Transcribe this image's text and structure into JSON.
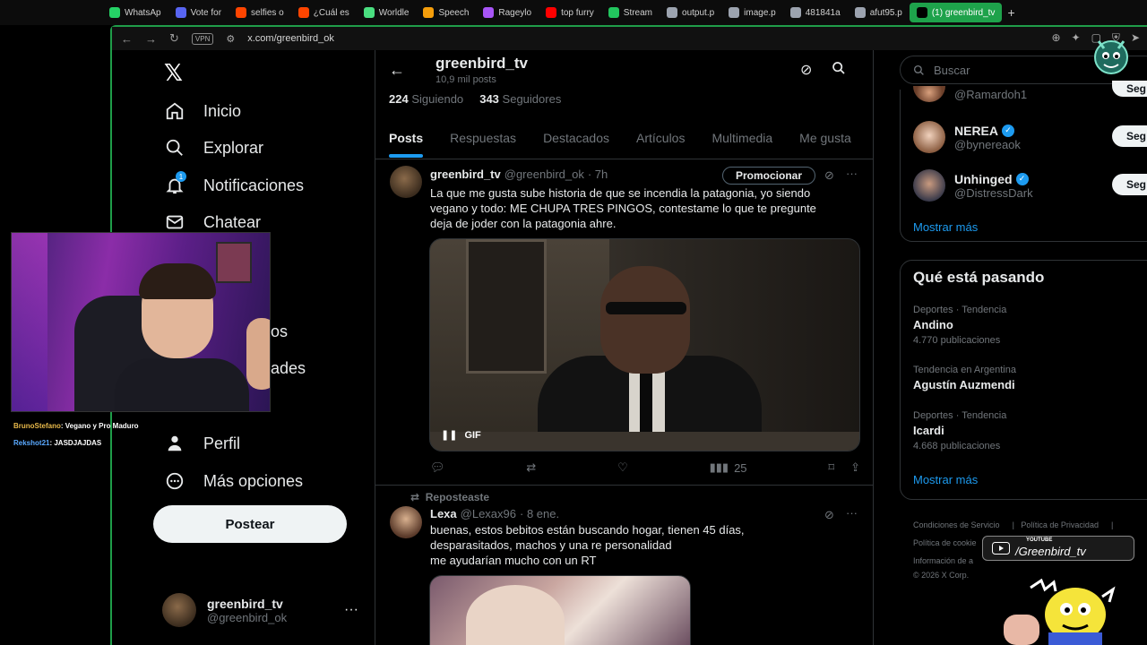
{
  "browser": {
    "tabs": [
      {
        "label": "WhatsAp",
        "color": "#25d366"
      },
      {
        "label": "Vote for",
        "color": "#5865f2"
      },
      {
        "label": "selfies o",
        "color": "#ff4500"
      },
      {
        "label": "¿Cuál es",
        "color": "#ff4500"
      },
      {
        "label": "Worldle",
        "color": "#4ade80"
      },
      {
        "label": "Speech",
        "color": "#f59e0b"
      },
      {
        "label": "Rageylo",
        "color": "#a855f7"
      },
      {
        "label": "top furry",
        "color": "#ff0000"
      },
      {
        "label": "Stream",
        "color": "#22c55e"
      },
      {
        "label": "output.p",
        "color": "#9ca3af"
      },
      {
        "label": "image.p",
        "color": "#9ca3af"
      },
      {
        "label": "481841a",
        "color": "#9ca3af"
      },
      {
        "label": "afut95.p",
        "color": "#9ca3af"
      }
    ],
    "active_tab": "(1) greenbird_tv",
    "url": "x.com/greenbird_ok",
    "vpn": "VPN",
    "accent": "#1f9d49"
  },
  "nav": {
    "inicio": "Inicio",
    "explorar": "Explorar",
    "notificaciones": "Notificaciones",
    "notif_count": "1",
    "chatear": "Chatear",
    "partial1": "os",
    "partial2": "ades",
    "perfil": "Perfil",
    "mas_opciones": "Más opciones",
    "postear": "Postear"
  },
  "account": {
    "name": "greenbird_tv",
    "handle": "@greenbird_ok"
  },
  "stream_chat": [
    {
      "user": "BrunoStefano",
      "msg": ": Vegano y Pro Maduro"
    },
    {
      "user": "Rekshot21",
      "msg": ": JASDJAJDAS"
    }
  ],
  "profile": {
    "name": "greenbird_tv",
    "posts": "10,9 mil posts",
    "following_count": "224",
    "following_label": "Siguiendo",
    "followers_count": "343",
    "followers_label": "Seguidores"
  },
  "tabs": [
    "Posts",
    "Respuestas",
    "Destacados",
    "Artículos",
    "Multimedia",
    "Me gusta"
  ],
  "tweet1": {
    "name": "greenbird_tv",
    "handle": "@greenbird_ok",
    "time": "· 7h",
    "promo": "Promocionar",
    "line1": "La que me gusta sube historia de que se incendia la patagonia, yo siendo",
    "line2": "vegano y todo: ME CHUPA TRES PINGOS, contestame lo que te pregunte",
    "line3": "deja de joder con la patagonia ahre.",
    "gif_label": "GIF",
    "views": "25"
  },
  "tweet2": {
    "reposted": "Reposteaste",
    "name": "Lexa",
    "handle": "@Lexax96",
    "time": "· 8 ene.",
    "line1": "buenas, estos bebitos están buscando hogar, tienen 45 días,",
    "line2": "desparasitados, machos y una re personalidad",
    "line3": "me ayudarían mucho con un RT"
  },
  "search": {
    "placeholder": "Buscar"
  },
  "who_to_follow": [
    {
      "name": "",
      "handle": "@Ramardoh1",
      "verified": false,
      "button": "Seg"
    },
    {
      "name": "NEREA",
      "handle": "@bynereaok",
      "verified": true,
      "button": "Seg"
    },
    {
      "name": "Unhinged",
      "handle": "@DistressDark",
      "verified": true,
      "button": "Seg"
    }
  ],
  "show_more": "Mostrar más",
  "trends": {
    "title": "Qué está pasando",
    "items": [
      {
        "meta": "Deportes · Tendencia",
        "name": "Andino",
        "count": "4.770 publicaciones"
      },
      {
        "meta": "Tendencia en Argentina",
        "name": "Agustín Auzmendi",
        "count": ""
      },
      {
        "meta": "Deportes · Tendencia",
        "name": "Icardi",
        "count": "4.668 publicaciones"
      }
    ]
  },
  "footer": {
    "terms": "Condiciones de Servicio",
    "privacy": "Política de Privacidad",
    "cookies": "Política de cookie",
    "info": "Información de a",
    "copyright": "© 2026 X Corp."
  },
  "overlay": {
    "yt_small": "YOUTUBE",
    "yt_name": "/Greenbird_tv"
  }
}
